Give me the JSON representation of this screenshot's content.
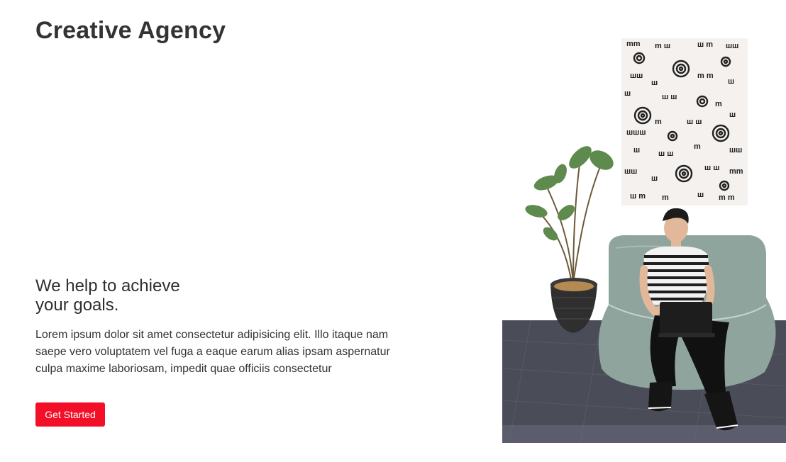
{
  "colors": {
    "accent": "#f20f27",
    "text": "#333333"
  },
  "header": {
    "brand": "Creative Agency",
    "menu_icon": "hamburger-menu-icon"
  },
  "hero": {
    "heading_line1": "We help to achieve",
    "heading_line2": "your goals.",
    "body": "Lorem ipsum dolor sit amet consectetur adipisicing elit. Illo itaque nam saepe vero voluptatem vel fuga a eaque earum alias ipsam aspernatur culpa maxime laboriosam, impedit quae officiis consectetur",
    "cta_label": "Get Started"
  }
}
